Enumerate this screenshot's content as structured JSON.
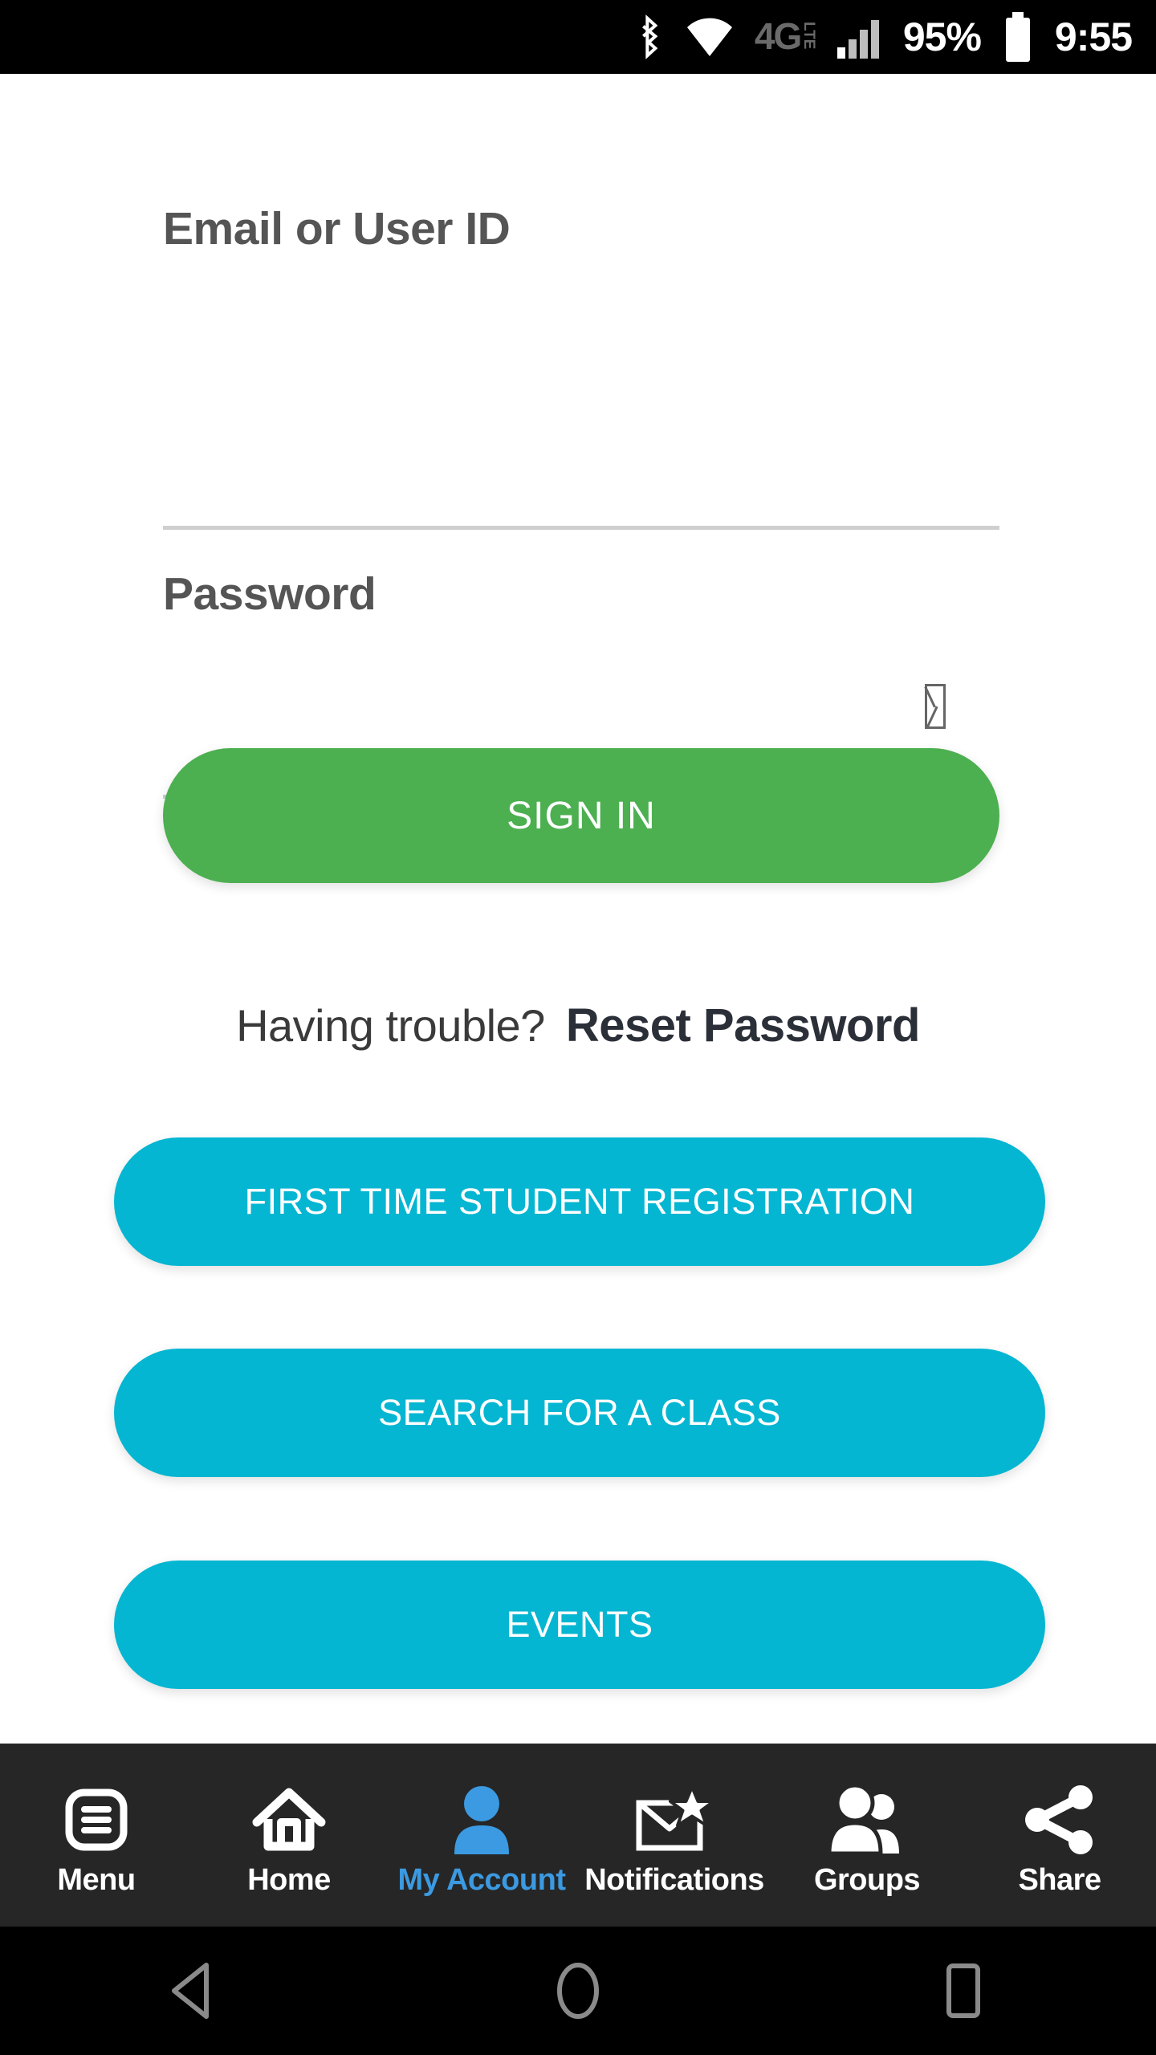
{
  "status_bar": {
    "bluetooth_icon": "bluetooth-icon",
    "wifi_icon": "wifi-icon",
    "network_type": "4G",
    "network_type_sub": "LTE",
    "signal_icon": "cellular-signal-icon",
    "battery_percent": "95%",
    "battery_icon": "battery-full-icon",
    "time": "9:55"
  },
  "form": {
    "email": {
      "label": "Email or User ID",
      "value": "",
      "placeholder": ""
    },
    "password": {
      "label": "Password",
      "value": "",
      "placeholder": "",
      "toggle_icon": "show-password-tofu-icon"
    }
  },
  "buttons": {
    "sign_in": "SIGN IN",
    "first_time_registration": "FIRST TIME STUDENT REGISTRATION",
    "search_class": "SEARCH FOR A CLASS",
    "events": "EVENTS"
  },
  "help": {
    "question": "Having trouble?",
    "link": "Reset Password"
  },
  "bottom_nav": {
    "items": [
      {
        "label": "Menu",
        "icon": "menu-list-icon",
        "active": false
      },
      {
        "label": "Home",
        "icon": "home-icon",
        "active": false
      },
      {
        "label": "My Account",
        "icon": "person-icon",
        "active": true
      },
      {
        "label": "Notifications",
        "icon": "envelope-star-icon",
        "active": false
      },
      {
        "label": "Groups",
        "icon": "people-group-icon",
        "active": false
      },
      {
        "label": "Share",
        "icon": "share-nodes-icon",
        "active": false
      }
    ]
  },
  "system_nav": {
    "back": "back-triangle-icon",
    "home": "home-circle-icon",
    "recents": "recents-square-icon"
  },
  "colors": {
    "green": "#4CAF50",
    "cyan": "#04B6D2",
    "accent_blue": "#3b9ae1",
    "status_bar_bg": "#000000",
    "nav_bg": "#262626",
    "label_gray": "#555555",
    "underline_gray": "#cfcfcf"
  }
}
